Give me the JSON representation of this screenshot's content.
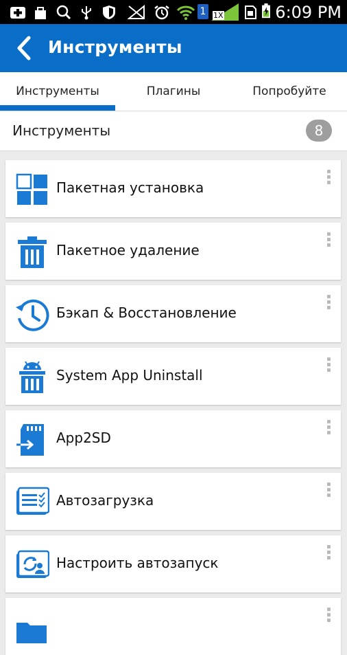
{
  "status_bar": {
    "time": "6:09 PM",
    "sim_label": "1",
    "speed_label": "1X"
  },
  "app_bar": {
    "title": "Инструменты"
  },
  "tabs": [
    {
      "label": "Инструменты",
      "active": true
    },
    {
      "label": "Плагины",
      "active": false
    },
    {
      "label": "Попробуйте",
      "active": false
    }
  ],
  "section": {
    "title": "Инструменты",
    "count": "8"
  },
  "items": [
    {
      "label": "Пакетная установка",
      "icon": "grid-install-icon"
    },
    {
      "label": "Пакетное удаление",
      "icon": "trash-icon"
    },
    {
      "label": "Бэкап & Восстановление",
      "icon": "history-clock-icon"
    },
    {
      "label": "System App Uninstall",
      "icon": "android-trash-icon"
    },
    {
      "label": "App2SD",
      "icon": "sd-card-icon"
    },
    {
      "label": "Автозагрузка",
      "icon": "autostart-list-icon"
    },
    {
      "label": "Настроить автозапуск",
      "icon": "autostart-settings-icon"
    },
    {
      "label": "",
      "icon": "folder-icon"
    }
  ],
  "colors": {
    "accent": "#0a6dc8",
    "icon_blue": "#1a7ad4",
    "badge": "#9e9e9e"
  }
}
